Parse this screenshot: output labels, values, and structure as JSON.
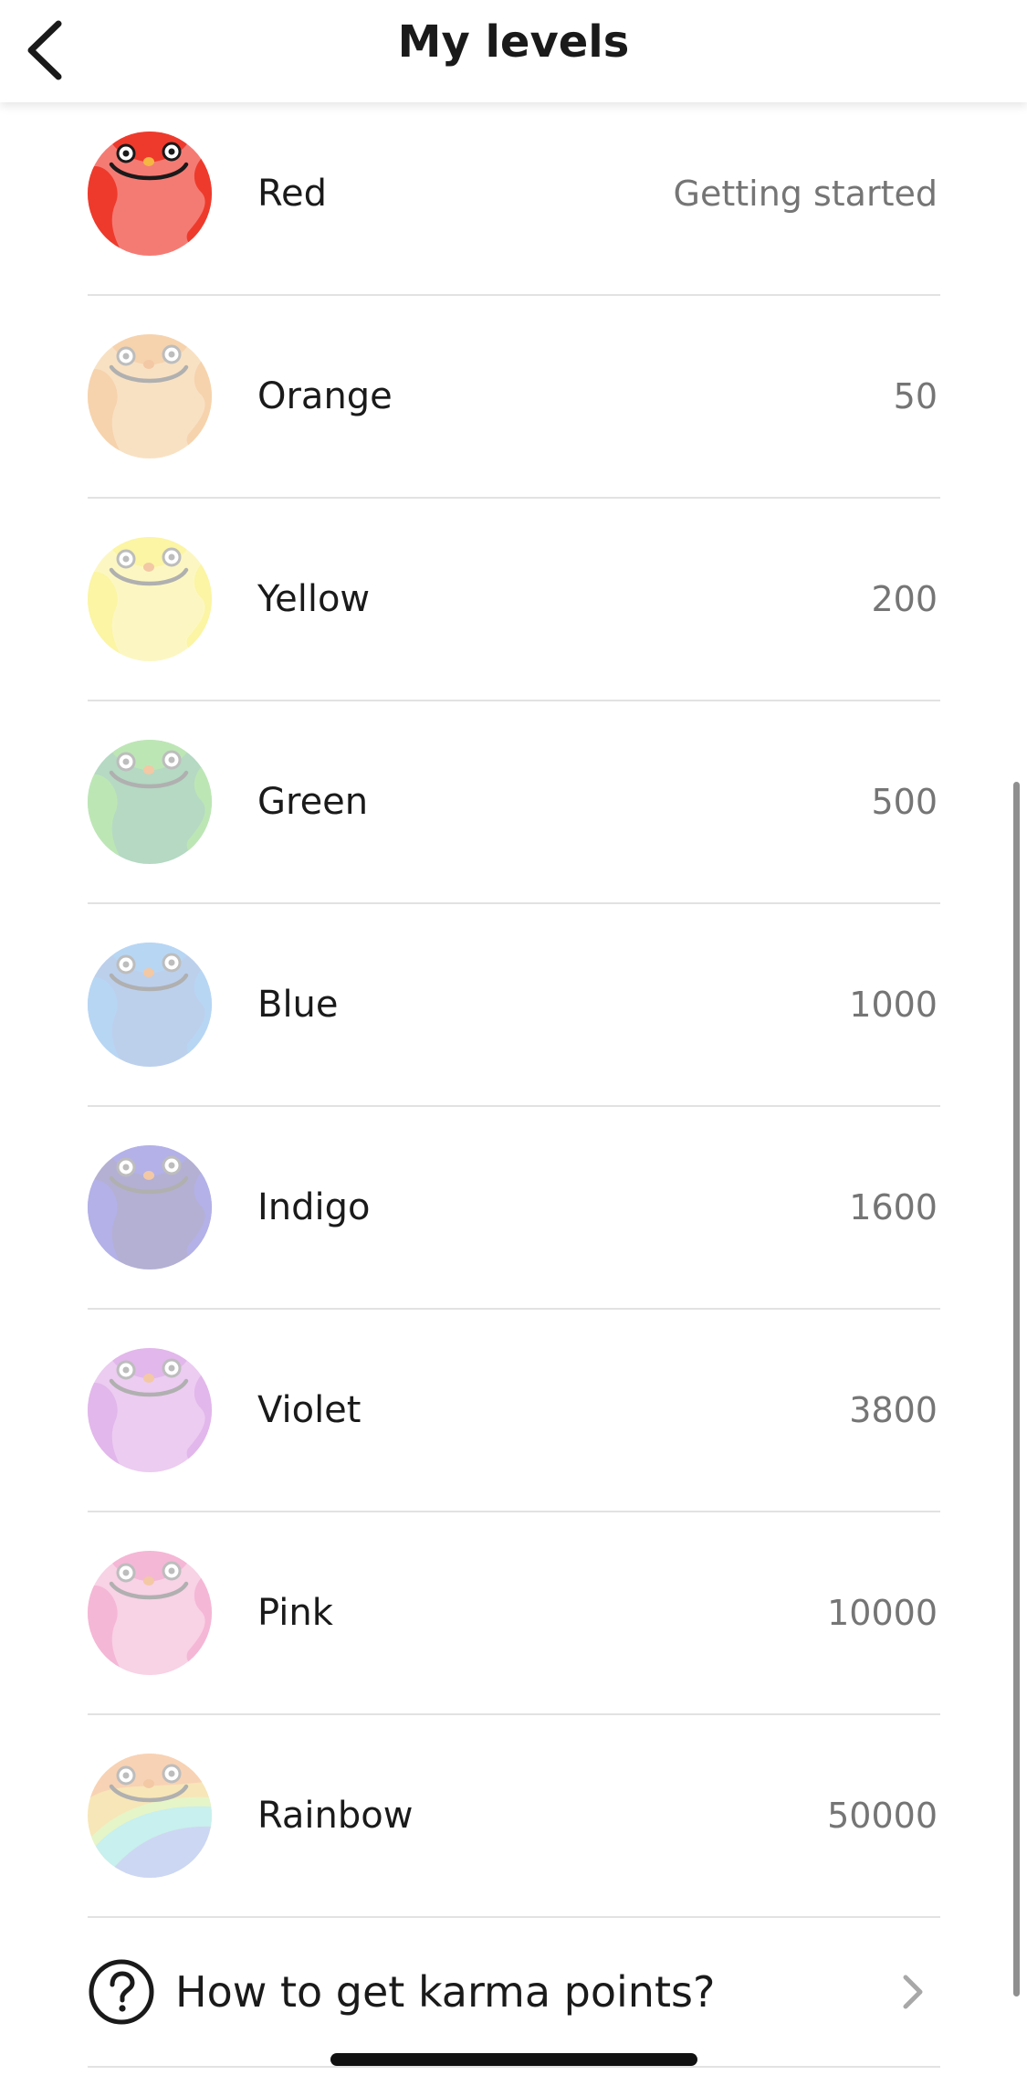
{
  "header": {
    "title": "My levels",
    "back_icon": "chevron-left-icon"
  },
  "levels": [
    {
      "name": "Red",
      "value": "Getting started",
      "color": "#ee3a2c",
      "light": "#f47b74",
      "active": true
    },
    {
      "name": "Orange",
      "value": "50",
      "color": "#f6d3ad",
      "light": "#f8e1c3",
      "active": false
    },
    {
      "name": "Yellow",
      "value": "200",
      "color": "#fbf5a4",
      "light": "#fcf7c2",
      "active": false
    },
    {
      "name": "Green",
      "value": "500",
      "color": "#bde6b5",
      "light": "#b5d9c3",
      "active": false
    },
    {
      "name": "Blue",
      "value": "1000",
      "color": "#b7d6f4",
      "light": "#bcd0ec",
      "active": false
    },
    {
      "name": "Indigo",
      "value": "1600",
      "color": "#b3b1e8",
      "light": "#b4b0d3",
      "active": false
    },
    {
      "name": "Violet",
      "value": "3800",
      "color": "#e2b7eb",
      "light": "#ecccf1",
      "active": false
    },
    {
      "name": "Pink",
      "value": "10000",
      "color": "#f5b7d6",
      "light": "#f8d2e5",
      "active": false
    },
    {
      "name": "Rainbow",
      "value": "50000",
      "color": "#f6e3b5",
      "light": "#c4eef2",
      "active": false
    }
  ],
  "help": {
    "label": "How to get karma points?",
    "icon": "question-circle-icon",
    "chevron": "chevron-right-icon"
  }
}
